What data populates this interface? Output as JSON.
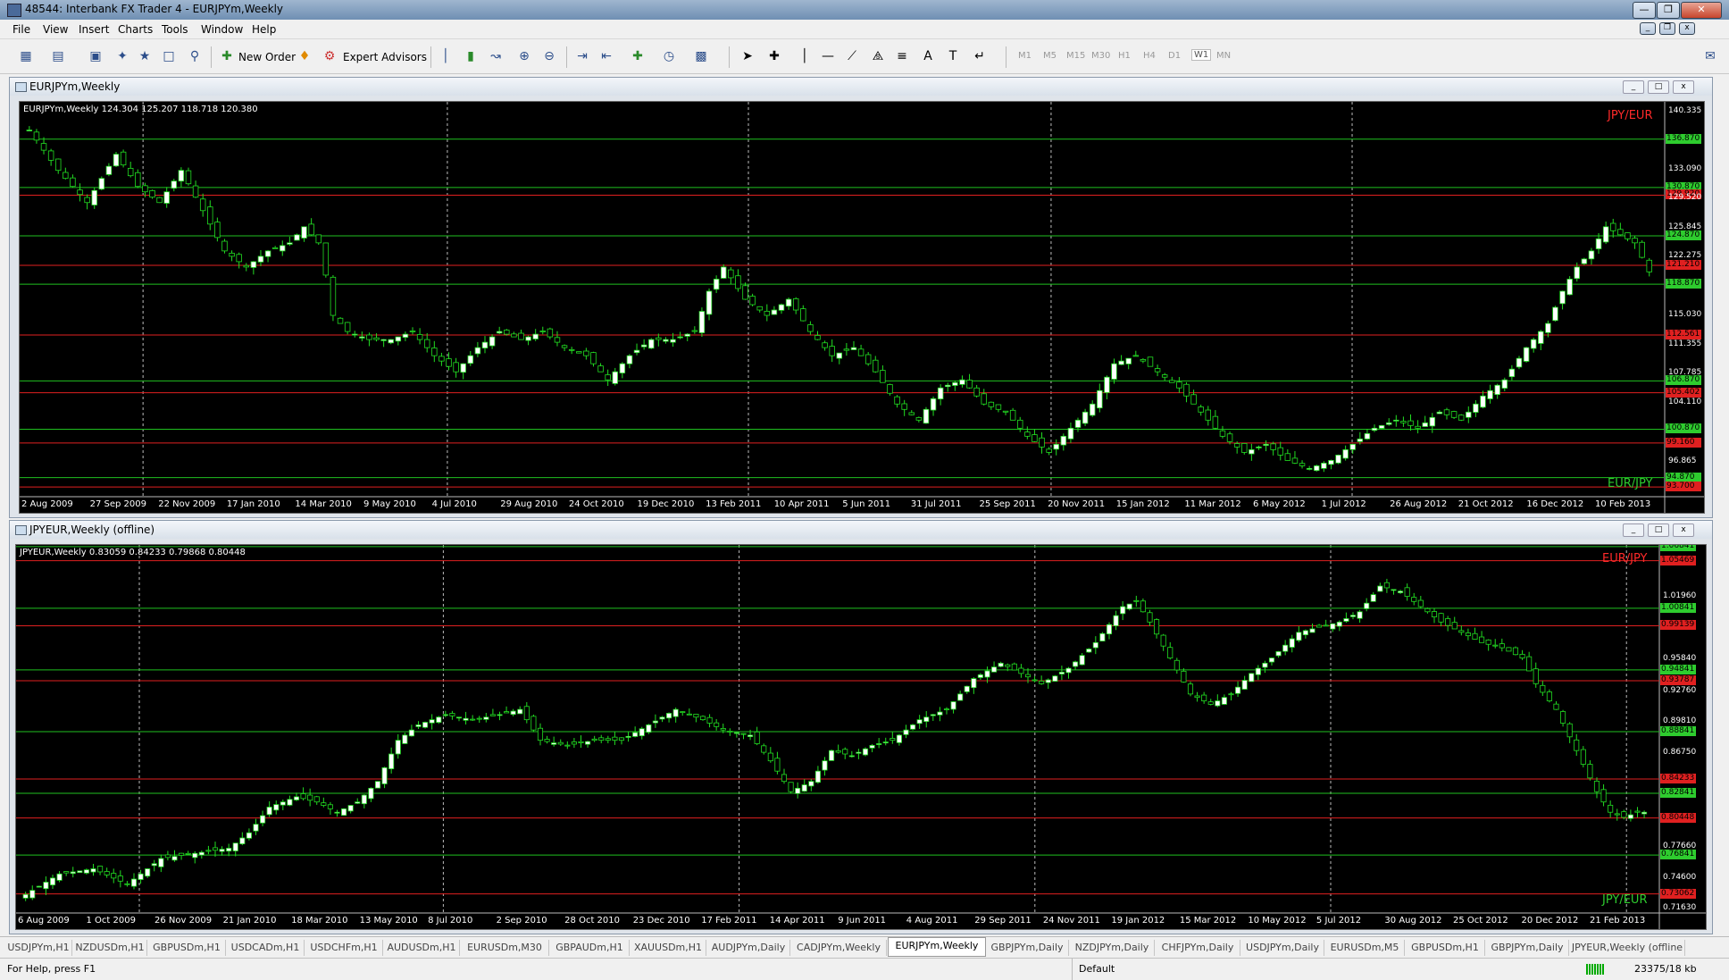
{
  "window": {
    "title": "48544: Interbank FX Trader 4 - EURJPYm,Weekly"
  },
  "menu": [
    "File",
    "View",
    "Insert",
    "Charts",
    "Tools",
    "Window",
    "Help"
  ],
  "toolbar": {
    "new_order": "New Order",
    "expert_advisors": "Expert Advisors",
    "timeframes": [
      "M1",
      "M5",
      "M15",
      "M30",
      "H1",
      "H4",
      "D1",
      "W1",
      "MN"
    ],
    "active_timeframe": "W1"
  },
  "chart_data": [
    {
      "type": "candlestick",
      "window_title": "EURJPYm,Weekly",
      "ohlc_label": "EURJPYm,Weekly  124.304 125.207 118.718 120.380",
      "pair_labels": [
        {
          "text": "JPY/EUR",
          "color": "#ff2a2a"
        },
        {
          "text": "EUR/JPY",
          "color": "#2ecc2e"
        }
      ],
      "x_tick_labels": [
        "2 Aug 2009",
        "27 Sep 2009",
        "22 Nov 2009",
        "17 Jan 2010",
        "14 Mar 2010",
        "9 May 2010",
        "4 Jul 2010",
        "29 Aug 2010",
        "24 Oct 2010",
        "19 Dec 2010",
        "13 Feb 2011",
        "10 Apr 2011",
        "5 Jun 2011",
        "31 Jul 2011",
        "25 Sep 2011",
        "20 Nov 2011",
        "15 Jan 2012",
        "11 Mar 2012",
        "6 May 2012",
        "1 Jul 2012",
        "26 Aug 2012",
        "21 Oct 2012",
        "16 Dec 2012",
        "10 Feb 2013"
      ],
      "y_tick_labels": [
        "140.335",
        "133.090",
        "129.520",
        "125.845",
        "122.275",
        "115.030",
        "111.355",
        "107.785",
        "104.110",
        "96.865"
      ],
      "ylim": [
        92.5,
        141.5
      ],
      "green_levels": [
        136.87,
        130.87,
        124.87,
        118.87,
        106.87,
        100.87,
        94.87
      ],
      "red_levels": [
        129.92,
        121.21,
        112.561,
        105.402,
        99.16,
        93.7
      ],
      "close_path": [
        [
          0,
          138
        ],
        [
          4,
          133
        ],
        [
          8,
          129
        ],
        [
          12,
          135
        ],
        [
          15,
          131
        ],
        [
          18,
          129
        ],
        [
          21,
          133
        ],
        [
          24,
          128
        ],
        [
          27,
          123
        ],
        [
          30,
          121
        ],
        [
          33,
          123
        ],
        [
          36,
          124
        ],
        [
          38,
          126
        ],
        [
          40,
          124
        ],
        [
          41,
          120
        ],
        [
          42,
          115
        ],
        [
          44,
          113
        ],
        [
          47,
          112
        ],
        [
          50,
          112
        ],
        [
          53,
          113
        ],
        [
          56,
          110
        ],
        [
          59,
          108
        ],
        [
          62,
          111
        ],
        [
          65,
          113
        ],
        [
          68,
          112
        ],
        [
          71,
          113
        ],
        [
          74,
          111
        ],
        [
          77,
          110
        ],
        [
          80,
          107
        ],
        [
          83,
          110
        ],
        [
          86,
          112
        ],
        [
          89,
          112
        ],
        [
          92,
          113
        ],
        [
          94,
          118
        ],
        [
          96,
          121
        ],
        [
          99,
          117
        ],
        [
          102,
          115
        ],
        [
          105,
          117
        ],
        [
          108,
          113
        ],
        [
          111,
          110
        ],
        [
          114,
          111
        ],
        [
          117,
          108
        ],
        [
          120,
          104
        ],
        [
          123,
          102
        ],
        [
          126,
          106
        ],
        [
          129,
          107
        ],
        [
          132,
          104
        ],
        [
          135,
          103
        ],
        [
          138,
          100
        ],
        [
          141,
          98
        ],
        [
          144,
          101
        ],
        [
          147,
          104
        ],
        [
          150,
          109
        ],
        [
          153,
          110
        ],
        [
          156,
          108
        ],
        [
          159,
          106
        ],
        [
          162,
          103
        ],
        [
          165,
          100
        ],
        [
          168,
          98
        ],
        [
          171,
          99
        ],
        [
          174,
          97
        ],
        [
          177,
          96
        ],
        [
          180,
          97
        ],
        [
          183,
          99
        ],
        [
          186,
          101
        ],
        [
          189,
          102
        ],
        [
          192,
          101
        ],
        [
          195,
          103
        ],
        [
          198,
          102
        ],
        [
          201,
          105
        ],
        [
          204,
          107
        ],
        [
          207,
          111
        ],
        [
          210,
          114
        ],
        [
          212,
          118
        ],
        [
          214,
          121
        ],
        [
          216,
          123
        ],
        [
          218,
          126
        ],
        [
          220,
          125
        ],
        [
          222,
          124
        ],
        [
          224,
          120.4
        ]
      ],
      "n_bars": 225
    },
    {
      "type": "candlestick",
      "window_title": "JPYEUR,Weekly (offline)",
      "ohlc_label": "JPYEUR,Weekly  0.83059 0.84233 0.79868 0.80448",
      "pair_labels": [
        {
          "text": "EUR/JPY",
          "color": "#ff2a2a"
        },
        {
          "text": "JPY/EUR",
          "color": "#2ecc2e"
        }
      ],
      "x_tick_labels": [
        "6 Aug 2009",
        "1 Oct 2009",
        "26 Nov 2009",
        "21 Jan 2010",
        "18 Mar 2010",
        "13 May 2010",
        "8 Jul 2010",
        "2 Sep 2010",
        "28 Oct 2010",
        "23 Dec 2010",
        "17 Feb 2011",
        "14 Apr 2011",
        "9 Jun 2011",
        "4 Aug 2011",
        "29 Sep 2011",
        "24 Nov 2011",
        "19 Jan 2012",
        "15 Mar 2012",
        "10 May 2012",
        "5 Jul 2012",
        "30 Aug 2012",
        "25 Oct 2012",
        "20 Dec 2012",
        "21 Feb 2013"
      ],
      "y_tick_labels": [
        "1.01960",
        "0.95840",
        "0.92760",
        "0.89810",
        "0.86750",
        "0.77660",
        "0.74600",
        "0.71630"
      ],
      "ylim": [
        0.712,
        1.07
      ],
      "green_levels": [
        1.06841,
        1.00841,
        0.94841,
        0.88841,
        0.82841,
        0.76841
      ],
      "red_levels": [
        1.05469,
        0.99139,
        0.93787,
        0.84233,
        0.80448,
        0.73062
      ],
      "close_path": [
        [
          0,
          0.73
        ],
        [
          5,
          0.75
        ],
        [
          10,
          0.755
        ],
        [
          15,
          0.74
        ],
        [
          20,
          0.765
        ],
        [
          25,
          0.77
        ],
        [
          30,
          0.775
        ],
        [
          33,
          0.79
        ],
        [
          36,
          0.815
        ],
        [
          40,
          0.825
        ],
        [
          43,
          0.82
        ],
        [
          46,
          0.81
        ],
        [
          49,
          0.82
        ],
        [
          52,
          0.84
        ],
        [
          55,
          0.88
        ],
        [
          58,
          0.895
        ],
        [
          62,
          0.905
        ],
        [
          66,
          0.9
        ],
        [
          70,
          0.905
        ],
        [
          73,
          0.91
        ],
        [
          76,
          0.88
        ],
        [
          80,
          0.875
        ],
        [
          84,
          0.88
        ],
        [
          88,
          0.88
        ],
        [
          92,
          0.895
        ],
        [
          96,
          0.91
        ],
        [
          100,
          0.9
        ],
        [
          103,
          0.89
        ],
        [
          107,
          0.885
        ],
        [
          110,
          0.86
        ],
        [
          113,
          0.83
        ],
        [
          116,
          0.84
        ],
        [
          119,
          0.87
        ],
        [
          122,
          0.865
        ],
        [
          125,
          0.875
        ],
        [
          128,
          0.88
        ],
        [
          132,
          0.9
        ],
        [
          136,
          0.91
        ],
        [
          140,
          0.94
        ],
        [
          144,
          0.955
        ],
        [
          147,
          0.945
        ],
        [
          150,
          0.935
        ],
        [
          154,
          0.95
        ],
        [
          158,
          0.975
        ],
        [
          162,
          1.01
        ],
        [
          164,
          1.015
        ],
        [
          166,
          0.995
        ],
        [
          169,
          0.96
        ],
        [
          172,
          0.925
        ],
        [
          175,
          0.915
        ],
        [
          178,
          0.925
        ],
        [
          181,
          0.945
        ],
        [
          184,
          0.96
        ],
        [
          188,
          0.985
        ],
        [
          191,
          0.99
        ],
        [
          194,
          0.995
        ],
        [
          197,
          1.005
        ],
        [
          200,
          1.03
        ],
        [
          203,
          1.025
        ],
        [
          206,
          1.01
        ],
        [
          209,
          0.995
        ],
        [
          212,
          0.985
        ],
        [
          215,
          0.975
        ],
        [
          218,
          0.97
        ],
        [
          221,
          0.96
        ],
        [
          223,
          0.935
        ],
        [
          226,
          0.91
        ],
        [
          229,
          0.87
        ],
        [
          232,
          0.83
        ],
        [
          234,
          0.81
        ],
        [
          236,
          0.805
        ],
        [
          238,
          0.81
        ]
      ],
      "n_bars": 240
    }
  ],
  "tabs": [
    "USDJPYm,H1",
    "NZDUSDm,H1",
    "GBPUSDm,H1",
    "USDCADm,H1",
    "USDCHFm,H1",
    "AUDUSDm,H1",
    "EURUSDm,M30",
    "GBPAUDm,H1",
    "XAUUSDm,H1",
    "AUDJPYm,Daily",
    "CADJPYm,Weekly",
    "EURJPYm,Weekly",
    "GBPJPYm,Daily",
    "NZDJPYm,Daily",
    "CHFJPYm,Daily",
    "USDJPYm,Daily",
    "EURUSDm,M5",
    "GBPUSDm,H1",
    "GBPJPYm,Daily",
    "JPYEUR,Weekly (offline"
  ],
  "active_tab": "EURJPYm,Weekly",
  "status": {
    "help": "For Help, press F1",
    "profile": "Default",
    "traffic": "23375/18 kb"
  },
  "colors": {
    "bull": "#ffffff",
    "bear": "#000000",
    "wick": "#22dd22",
    "green_level": "#1fbf1f",
    "red_level": "#e02020"
  }
}
